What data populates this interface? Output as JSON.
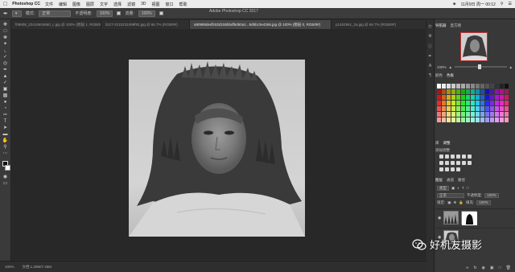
{
  "menubar": {
    "app_name": "Photoshop CC",
    "items": [
      "文件",
      "编辑",
      "图像",
      "图层",
      "文字",
      "选择",
      "滤镜",
      "3D",
      "视图",
      "窗口",
      "帮助"
    ],
    "clock": "11月9日 周一 00:12"
  },
  "options": {
    "window_title": "Adobe Photoshop CC 2017",
    "mode_label": "模式:",
    "mode_value": "正常",
    "opacity_label": "不透明度:",
    "opacity_value": "100%",
    "flow_label": "流量:",
    "flow_value": "100%"
  },
  "tabs": [
    {
      "label": "f09808_22416604660_c.jpg @ 100% (图层 1, RGB/8#)",
      "active": false
    },
    {
      "label": "b117-2210231099f93.jpg @ 66.7% (RGB/8#)",
      "active": false
    },
    {
      "label": "a90989dedfc82d155bbdf5d60a1...9d5bc3e4266.jpg @ 100% (图层 0, RGB/8#)",
      "active": true
    },
    {
      "label": "p1452561_2a.jpg @ 66.7% (RGB/8#)",
      "active": false
    }
  ],
  "statusbar": {
    "zoom": "100%",
    "doc_size": "文档:1.29M/7.45M"
  },
  "panels": {
    "navigator_tabs": [
      "导航器",
      "直方图"
    ],
    "nav_zoom": "100%",
    "color_tabs": [
      "颜色",
      "色板"
    ],
    "adjust_tabs": [
      "库",
      "调整"
    ],
    "adjust_label": "添加调整",
    "layer_tabs": [
      "图层",
      "通道",
      "路径"
    ],
    "kind_label": "类型",
    "blend_mode": "正常",
    "opacity_label": "不透明度:",
    "opacity_value": "100%",
    "lock_label": "锁定:",
    "fill_label": "填充:",
    "fill_value": "100%"
  },
  "watermark": {
    "text": "好机友摄影"
  },
  "colors": {
    "accent_selection": "#c03030",
    "panel_bg": "#383838",
    "canvas_bg": "#282828"
  }
}
